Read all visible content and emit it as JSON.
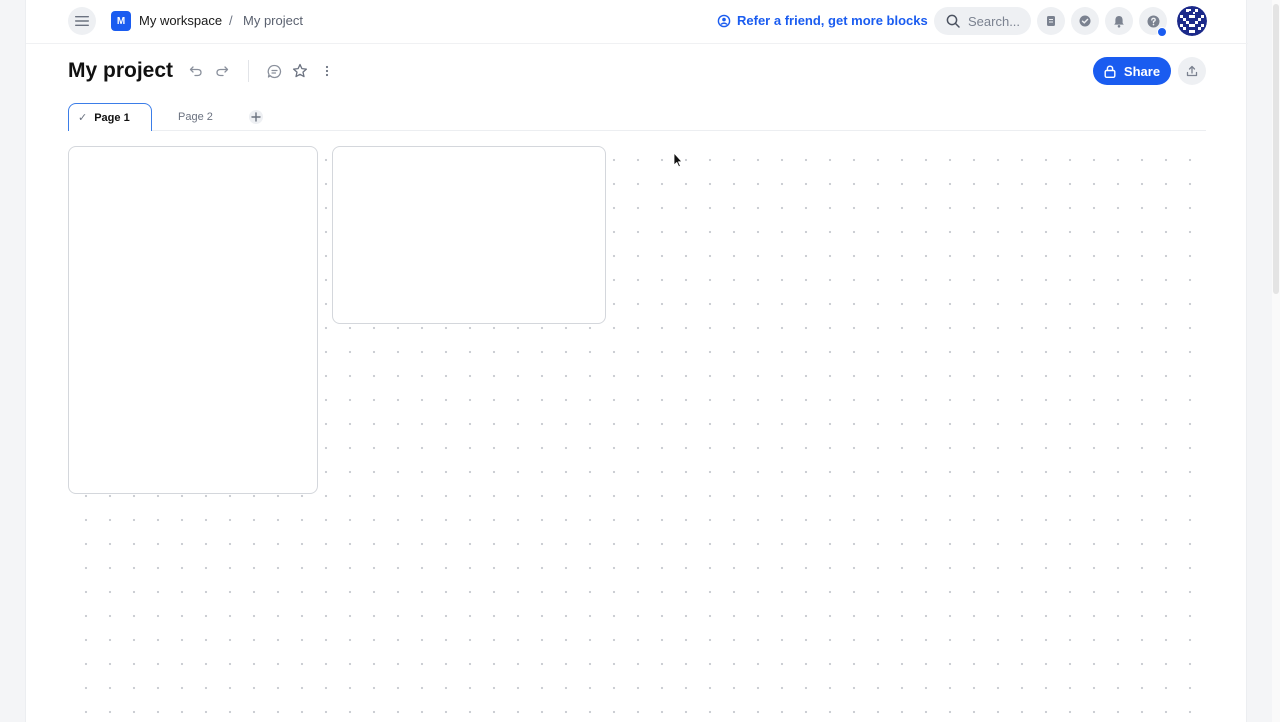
{
  "header": {
    "workspace_initial": "M",
    "workspace_name": "My workspace",
    "separator": "/",
    "project_crumb": "My project",
    "refer_label": "Refer a friend, get more blocks",
    "search_placeholder": "Search..."
  },
  "toolbar": {
    "title": "My project",
    "share_label": "Share"
  },
  "tabs": [
    {
      "label": "Page 1",
      "active": true
    },
    {
      "label": "Page 2",
      "active": false
    }
  ],
  "colors": {
    "accent": "#1a5cf0",
    "tab_active_border": "#3b7de8"
  },
  "icons": {
    "menu": "hamburger-icon",
    "refer": "refer-friend-icon",
    "search": "search-icon",
    "doc": "document-icon",
    "tasks": "check-circle-icon",
    "notifications": "bell-icon",
    "help": "help-icon",
    "undo": "undo-icon",
    "redo": "redo-icon",
    "comment": "comment-icon",
    "favorite": "star-icon",
    "more": "more-vertical-icon",
    "share": "lock-icon",
    "export": "upload-icon",
    "add_page": "plus-icon"
  }
}
